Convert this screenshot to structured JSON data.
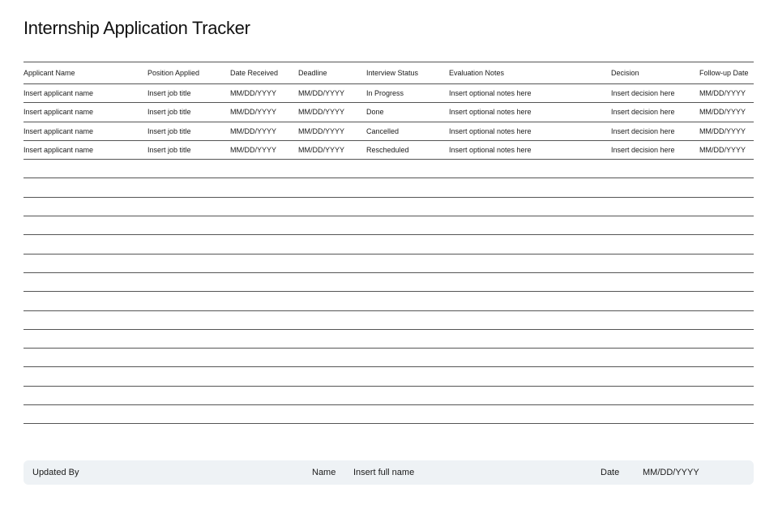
{
  "title": "Internship Application Tracker",
  "columns": [
    "Applicant Name",
    "Position Applied",
    "Date Received",
    "Deadline",
    "Interview Status",
    "Evaluation Notes",
    "Decision",
    "Follow-up Date"
  ],
  "rows": [
    [
      "Insert applicant name",
      "Insert job title",
      "MM/DD/YYYY",
      "MM/DD/YYYY",
      "In Progress",
      "Insert optional notes here",
      "Insert decision here",
      "MM/DD/YYYY"
    ],
    [
      "Insert applicant name",
      "Insert job title",
      "MM/DD/YYYY",
      "MM/DD/YYYY",
      "Done",
      "Insert optional notes here",
      "Insert decision here",
      "MM/DD/YYYY"
    ],
    [
      "Insert applicant name",
      "Insert job title",
      "MM/DD/YYYY",
      "MM/DD/YYYY",
      "Cancelled",
      "Insert optional notes here",
      "Insert decision here",
      "MM/DD/YYYY"
    ],
    [
      "Insert applicant name",
      "Insert job title",
      "MM/DD/YYYY",
      "MM/DD/YYYY",
      "Rescheduled",
      "Insert optional notes here",
      "Insert decision here",
      "MM/DD/YYYY"
    ]
  ],
  "empty_rows": 14,
  "footer": {
    "updated_by_label": "Updated By",
    "name_label": "Name",
    "name_value": "Insert full name",
    "date_label": "Date",
    "date_value": "MM/DD/YYYY"
  },
  "colors": {
    "rule": "#555555",
    "footer_bg": "#eef2f5",
    "text": "#1a1a1a"
  }
}
